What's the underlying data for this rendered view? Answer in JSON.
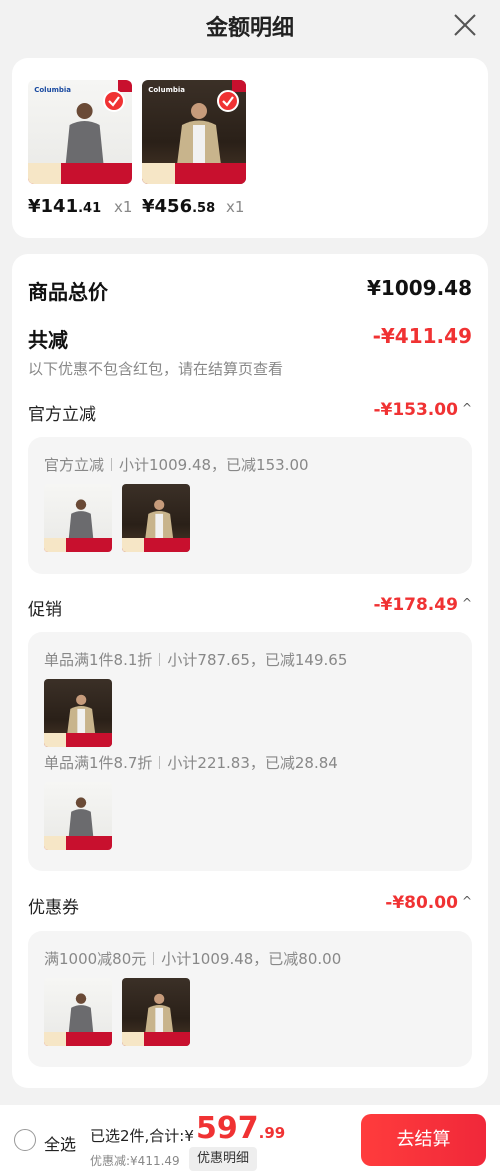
{
  "header": {
    "title": "金额明细"
  },
  "products": [
    {
      "brand": "Columbia",
      "price_int": "¥141",
      "price_dec": ".41",
      "qty": "x1"
    },
    {
      "brand": "Columbia",
      "price_int": "¥456",
      "price_dec": ".58",
      "qty": "x1"
    }
  ],
  "summary": {
    "total_label": "商品总价",
    "total_amount": "¥1009.48",
    "reduce_label": "共减",
    "reduce_amount": "-¥411.49",
    "hint": "以下优惠不包含红包，请在结算页查看"
  },
  "sections": {
    "official": {
      "label": "官方立减",
      "amount": "-¥153.00",
      "chevron": "^",
      "line_name": "官方立减",
      "line_detail": "小计1009.48，已减153.00"
    },
    "promo": {
      "label": "促销",
      "amount": "-¥178.49",
      "chevron": "^",
      "line1_name": "单品满1件8.1折",
      "line1_detail": "小计787.65，已减149.65",
      "line2_name": "单品满1件8.7折",
      "line2_detail": "小计221.83，已减28.84"
    },
    "coupon": {
      "label": "优惠券",
      "amount": "-¥80.00",
      "chevron": "^",
      "line_name": "满1000减80元",
      "line_detail": "小计1009.48，已减80.00"
    }
  },
  "footer": {
    "select_all": "全选",
    "selected_summary": "已选2件,合计:¥",
    "total_int": "597",
    "total_dec": ".99",
    "discount_text": "优惠减:¥411.49",
    "detail_button": "优惠明细",
    "checkout_button": "去结算"
  },
  "colors": {
    "accent_red": "#f03233",
    "brand_red": "#c8102e"
  },
  "icons": {
    "close": "close-icon",
    "check": "check-icon",
    "chevron": "chevron-up-icon"
  }
}
